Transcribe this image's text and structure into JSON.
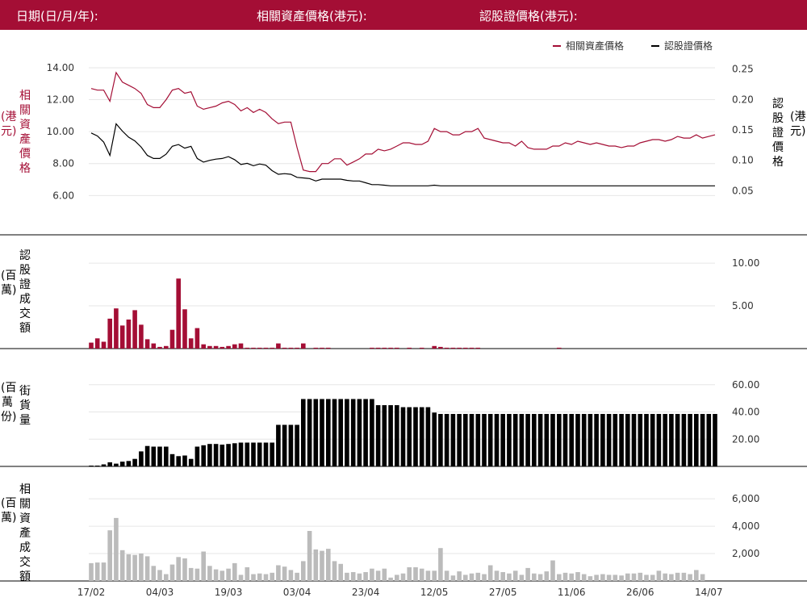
{
  "header": {
    "date_label": "日期(日/月/年):",
    "underlying_price_label": "相關資產價格(港元):",
    "warrant_price_label": "認股證價格(港元):"
  },
  "legend": {
    "underlying": "相關資產價格",
    "warrant": "認股證價格"
  },
  "axis_labels": {
    "underlying_price": "相關資產價格",
    "underlying_price_unit": "(港元)",
    "warrant_price": "認股證價格",
    "warrant_price_unit": "(港元)",
    "warrant_turnover": "認股證成交額",
    "warrant_turnover_unit": "(百萬)",
    "outstanding": "街貨量",
    "outstanding_unit": "(百萬份)",
    "underlying_turnover": "相關資產成交額",
    "underlying_turnover_unit": "(百萬)"
  },
  "colors": {
    "brand": "#a40e35",
    "underlying": "#a40e35",
    "warrant": "#000000",
    "warrant_turnover": "#a40e35",
    "outstanding": "#000000",
    "underlying_turnover": "#bbbbbb",
    "grid": "#e6e6e6"
  },
  "chart_data": [
    {
      "type": "line",
      "name": "price",
      "x_ticks": [
        "17/02",
        "04/03",
        "19/03",
        "03/04",
        "23/04",
        "12/05",
        "27/05",
        "11/06",
        "26/06",
        "14/07"
      ],
      "x_tick_index": [
        0,
        11,
        22,
        33,
        44,
        55,
        66,
        77,
        88,
        99
      ],
      "left_axis": {
        "ticks": [
          "6.00",
          "8.00",
          "10.00",
          "12.00",
          "14.00"
        ],
        "range": [
          4.4,
          14.2
        ]
      },
      "right_axis": {
        "ticks": [
          "0.05",
          "0.10",
          "0.15",
          "0.20",
          "0.25"
        ],
        "range": [
          0.0,
          0.2575
        ]
      },
      "series": [
        {
          "name": "相關資產價格",
          "axis": "left",
          "values": [
            12.7,
            12.6,
            12.6,
            11.9,
            13.7,
            13.1,
            12.9,
            12.7,
            12.4,
            11.7,
            11.5,
            11.5,
            12.0,
            12.6,
            12.7,
            12.4,
            12.5,
            11.6,
            11.4,
            11.5,
            11.6,
            11.8,
            11.9,
            11.7,
            11.3,
            11.5,
            11.2,
            11.4,
            11.2,
            10.8,
            10.5,
            10.6,
            10.6,
            9.0,
            7.6,
            7.5,
            7.5,
            8.0,
            8.0,
            8.3,
            8.3,
            7.9,
            8.1,
            8.3,
            8.6,
            8.6,
            8.9,
            8.8,
            8.9,
            9.1,
            9.3,
            9.3,
            9.2,
            9.2,
            9.4,
            10.2,
            10.0,
            10.0,
            9.8,
            9.8,
            10.0,
            10.0,
            10.2,
            9.6,
            9.5,
            9.4,
            9.3,
            9.3,
            9.1,
            9.4,
            9.0,
            8.9,
            8.9,
            8.9,
            9.1,
            9.1,
            9.3,
            9.2,
            9.4,
            9.3,
            9.2,
            9.3,
            9.2,
            9.1,
            9.1,
            9.0,
            9.1,
            9.1,
            9.3,
            9.4,
            9.5,
            9.5,
            9.4,
            9.5,
            9.7,
            9.6,
            9.6,
            9.8,
            9.6,
            9.7,
            9.8
          ]
        },
        {
          "name": "認股證價格",
          "axis": "right",
          "values": [
            0.145,
            0.14,
            0.13,
            0.108,
            0.16,
            0.148,
            0.138,
            0.132,
            0.122,
            0.108,
            0.103,
            0.103,
            0.11,
            0.123,
            0.126,
            0.12,
            0.123,
            0.103,
            0.097,
            0.1,
            0.102,
            0.103,
            0.106,
            0.101,
            0.093,
            0.095,
            0.091,
            0.094,
            0.092,
            0.083,
            0.077,
            0.078,
            0.077,
            0.072,
            0.071,
            0.07,
            0.066,
            0.069,
            0.069,
            0.069,
            0.069,
            0.067,
            0.066,
            0.066,
            0.063,
            0.06,
            0.06,
            0.059,
            0.058,
            0.058,
            0.058,
            0.058,
            0.058,
            0.058,
            0.058,
            0.059,
            0.058,
            0.058,
            0.058,
            0.058,
            0.058,
            0.058,
            0.058,
            0.058,
            0.058,
            0.058,
            0.058,
            0.058,
            0.058,
            0.058,
            0.058,
            0.058,
            0.058,
            0.058,
            0.058,
            0.058,
            0.058,
            0.058,
            0.058,
            0.058,
            0.058,
            0.058,
            0.058,
            0.058,
            0.058,
            0.058,
            0.058,
            0.058,
            0.058,
            0.058,
            0.058,
            0.058,
            0.058,
            0.058,
            0.058,
            0.058,
            0.058,
            0.058,
            0.058,
            0.058,
            0.058
          ]
        }
      ]
    },
    {
      "type": "bar",
      "name": "warrant_turnover",
      "right_axis": {
        "ticks": [
          "5.00",
          "10.00"
        ],
        "range": [
          0,
          10.2
        ]
      },
      "values": [
        0.7,
        1.2,
        0.8,
        3.5,
        4.7,
        2.7,
        3.4,
        4.5,
        2.8,
        1.1,
        0.6,
        0.2,
        0.3,
        2.2,
        8.2,
        4.6,
        1.2,
        2.4,
        0.5,
        0.3,
        0.3,
        0.2,
        0.3,
        0.5,
        0.6,
        0.1,
        0.1,
        0.1,
        0.1,
        0.1,
        0.6,
        0.1,
        0.1,
        0.1,
        0.6,
        0,
        0.1,
        0.1,
        0.1,
        0,
        0,
        0,
        0,
        0,
        0,
        0.1,
        0.1,
        0.1,
        0.1,
        0.1,
        0,
        0.1,
        0,
        0.1,
        0,
        0.3,
        0.2,
        0.1,
        0.1,
        0.1,
        0.1,
        0.1,
        0.1,
        0,
        0,
        0,
        0,
        0,
        0,
        0,
        0,
        0,
        0,
        0,
        0,
        0.1,
        0,
        0,
        0,
        0,
        0,
        0,
        0,
        0,
        0,
        0,
        0,
        0,
        0,
        0,
        0,
        0,
        0,
        0,
        0,
        0,
        0,
        0,
        0,
        0,
        0
      ]
    },
    {
      "type": "bar",
      "name": "outstanding",
      "right_axis": {
        "ticks": [
          "20.00",
          "40.00",
          "60.00"
        ],
        "range": [
          0,
          64
        ]
      },
      "values": [
        0.5,
        0.5,
        1.5,
        3,
        2,
        3.5,
        4,
        5.5,
        11,
        15,
        14.5,
        14.5,
        14.5,
        9,
        7.5,
        8,
        5.5,
        14.5,
        15.5,
        16.5,
        16.5,
        16,
        16.5,
        17,
        17.5,
        17.5,
        17.5,
        17.5,
        17.5,
        17.5,
        30.5,
        30.5,
        30.5,
        30.5,
        49.5,
        49.5,
        49.5,
        49.5,
        49.5,
        49.5,
        49.5,
        49.5,
        49.5,
        49.5,
        49.5,
        49.5,
        45,
        45,
        45,
        45,
        43.5,
        43.5,
        43.5,
        43.5,
        43.5,
        39.5,
        38.5,
        38.5,
        38.5,
        38.5,
        38.5,
        38.5,
        38.5,
        38.5,
        38.5,
        38.5,
        38.5,
        38.5,
        38.5,
        38.5,
        38.5,
        38.5,
        38.5,
        38.5,
        38.5,
        38.5,
        38.5,
        38.5,
        38.5,
        38.5,
        38.5,
        38.5,
        38.5,
        38.5,
        38.5,
        38.5,
        38.5,
        38.5,
        38.5,
        38.5,
        38.5,
        38.5,
        38.5,
        38.5,
        38.5,
        38.5,
        38.5,
        38.5,
        38.5,
        38.5,
        38.5
      ]
    },
    {
      "type": "bar",
      "name": "underlying_turnover",
      "right_axis": {
        "ticks": [
          "2,000",
          "4,000",
          "6,000"
        ],
        "range": [
          0,
          6300
        ]
      },
      "values": [
        1300,
        1350,
        1350,
        3700,
        4600,
        2250,
        1950,
        1900,
        2000,
        1800,
        1100,
        800,
        500,
        1200,
        1750,
        1650,
        950,
        900,
        2150,
        1100,
        850,
        750,
        900,
        1300,
        450,
        1000,
        500,
        550,
        500,
        600,
        1150,
        1050,
        800,
        600,
        1450,
        3650,
        2300,
        2200,
        2350,
        1450,
        1250,
        600,
        650,
        550,
        650,
        900,
        750,
        900,
        250,
        450,
        550,
        1000,
        1000,
        900,
        750,
        750,
        2400,
        750,
        400,
        700,
        450,
        550,
        600,
        500,
        1150,
        750,
        650,
        550,
        750,
        450,
        950,
        550,
        500,
        700,
        1500,
        500,
        600,
        550,
        650,
        500,
        350,
        450,
        500,
        450,
        450,
        400,
        550,
        550,
        600,
        450,
        450,
        750,
        550,
        500,
        600,
        600,
        500,
        800,
        500
      ]
    }
  ]
}
